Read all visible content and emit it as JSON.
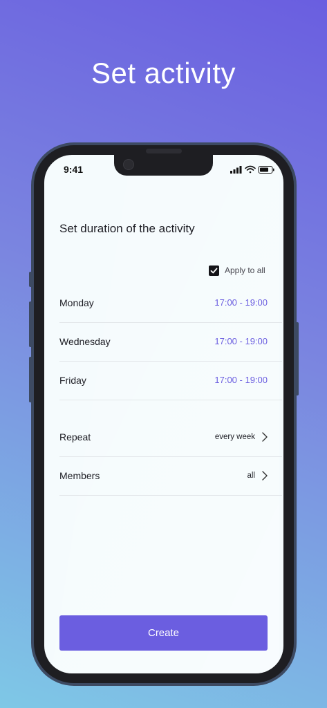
{
  "headline": "Set activity",
  "status_bar": {
    "time": "9:41"
  },
  "screen": {
    "title": "Set duration of the activity",
    "apply_to_all": {
      "label": "Apply to all",
      "checked": true
    },
    "days": [
      {
        "day": "Monday",
        "time": "17:00 - 19:00"
      },
      {
        "day": "Wednesday",
        "time": "17:00 - 19:00"
      },
      {
        "day": "Friday",
        "time": "17:00 - 19:00"
      }
    ],
    "repeat": {
      "label": "Repeat",
      "value": "every week"
    },
    "members": {
      "label": "Members",
      "value": "all"
    },
    "create_label": "Create"
  },
  "colors": {
    "accent": "#6b5ee0",
    "background_top": "#6a5ee0",
    "background_bottom": "#7ec8e6",
    "screen": "#f5fbfd"
  },
  "icons": [
    "signal-icon",
    "wifi-icon",
    "battery-icon",
    "checkmark-icon",
    "chevron-right-icon"
  ]
}
